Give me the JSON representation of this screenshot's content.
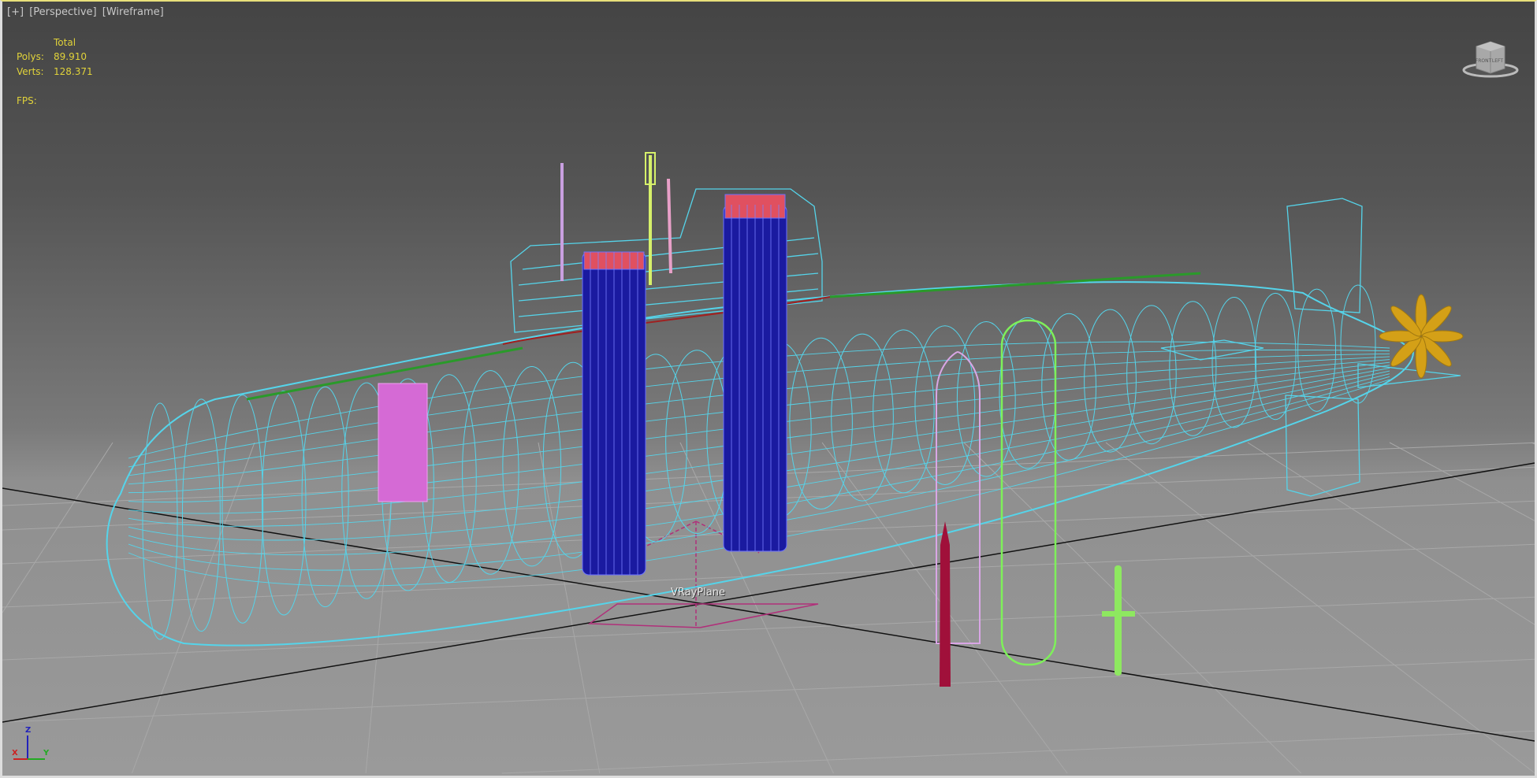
{
  "viewport": {
    "menu": [
      "[+]",
      "[Perspective]",
      "[Wireframe]"
    ],
    "stats": {
      "header": "Total",
      "polys_label": "Polys:",
      "polys_value": "89.910",
      "verts_label": "Verts:",
      "verts_value": "128.371",
      "fps_label": "FPS:"
    },
    "object_label": "VRayPlane",
    "viewcube": {
      "left_face": "FRONT",
      "right_face": "LEFT"
    },
    "axes": {
      "x": "X",
      "y": "Y",
      "z": "Z"
    },
    "colors": {
      "hull": "#55d4ea",
      "tubes": "#1a1aa0",
      "missile_pink": "#d9a6e6",
      "cylinder_green": "#7ef05a",
      "missile_red": "#a0103a",
      "propeller": "#d4a017",
      "stats_text": "#e0d23a",
      "vrayplane": "#b0307a"
    }
  }
}
